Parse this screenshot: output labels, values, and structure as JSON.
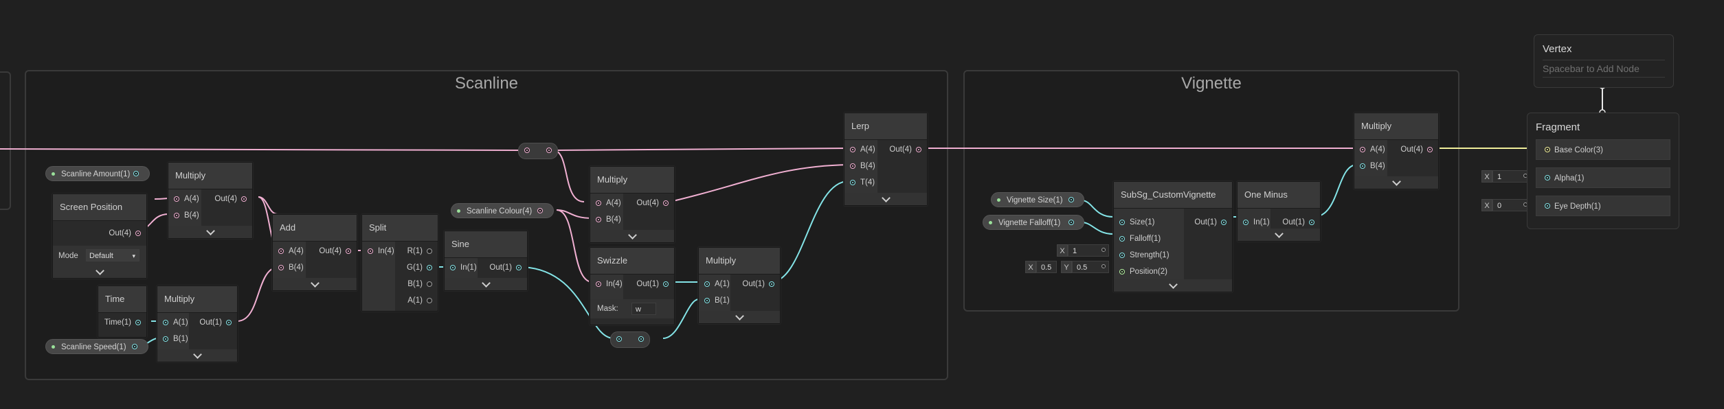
{
  "groups": {
    "scanline": {
      "title": "Scanline"
    },
    "vignette": {
      "title": "Vignette"
    }
  },
  "nodes": {
    "multiply1": {
      "title": "Multiply",
      "in_a": "A(4)",
      "in_b": "B(4)",
      "out": "Out(4)"
    },
    "screen_position": {
      "title": "Screen Position",
      "out": "Out(4)",
      "mode_label": "Mode",
      "mode_value": "Default"
    },
    "time": {
      "title": "Time",
      "out": "Time(1)"
    },
    "multiply2": {
      "title": "Multiply",
      "in_a": "A(1)",
      "in_b": "B(1)",
      "out": "Out(1)"
    },
    "add": {
      "title": "Add",
      "in_a": "A(4)",
      "in_b": "B(4)",
      "out": "Out(4)"
    },
    "split": {
      "title": "Split",
      "in": "In(4)",
      "out_r": "R(1)",
      "out_g": "G(1)",
      "out_b": "B(1)",
      "out_a": "A(1)"
    },
    "sine": {
      "title": "Sine",
      "in": "In(1)",
      "out": "Out(1)"
    },
    "multiply3": {
      "title": "Multiply",
      "in_a": "A(4)",
      "in_b": "B(4)",
      "out": "Out(4)"
    },
    "swizzle": {
      "title": "Swizzle",
      "in": "In(4)",
      "out": "Out(1)",
      "mask_label": "Mask:",
      "mask_value": "w"
    },
    "multiply4": {
      "title": "Multiply",
      "in_a": "A(1)",
      "in_b": "B(1)",
      "out": "Out(1)"
    },
    "lerp": {
      "title": "Lerp",
      "in_a": "A(4)",
      "in_b": "B(4)",
      "in_t": "T(4)",
      "out": "Out(4)"
    },
    "custom_vignette": {
      "title": "SubSg_CustomVignette",
      "in_size": "Size(1)",
      "in_falloff": "Falloff(1)",
      "in_strength": "Strength(1)",
      "in_position": "Position(2)",
      "out": "Out(1)"
    },
    "one_minus": {
      "title": "One Minus",
      "in": "In(1)",
      "out": "Out(1)"
    },
    "multiply5": {
      "title": "Multiply",
      "in_a": "A(4)",
      "in_b": "B(4)",
      "out": "Out(4)"
    }
  },
  "properties": {
    "scanline_amount": "Scanline Amount(1)",
    "scanline_speed": "Scanline Speed(1)",
    "scanline_colour": "Scanline Colour(4)",
    "vignette_size": "Vignette Size(1)",
    "vignette_falloff": "Vignette Falloff(1)"
  },
  "inline_values": {
    "strength_x_label": "X",
    "strength_x": "1",
    "position_x_label": "X",
    "position_x": "0.5",
    "position_y_label": "Y",
    "position_y": "0.5",
    "alpha_x_label": "X",
    "alpha_x": "1",
    "eye_depth_x_label": "X",
    "eye_depth_x": "0"
  },
  "master": {
    "vertex_title": "Vertex",
    "vertex_hint": "Spacebar to Add Node",
    "fragment_title": "Fragment",
    "base_color": "Base Color(3)",
    "alpha": "Alpha(1)",
    "eye_depth": "Eye Depth(1)"
  },
  "colors": {
    "background": "#202020",
    "vector4_wire": "#f1b0d2",
    "float_wire": "#84e4e7",
    "vector3_wire": "#f2f09b",
    "vector2_wire": "#b6f5a2"
  }
}
